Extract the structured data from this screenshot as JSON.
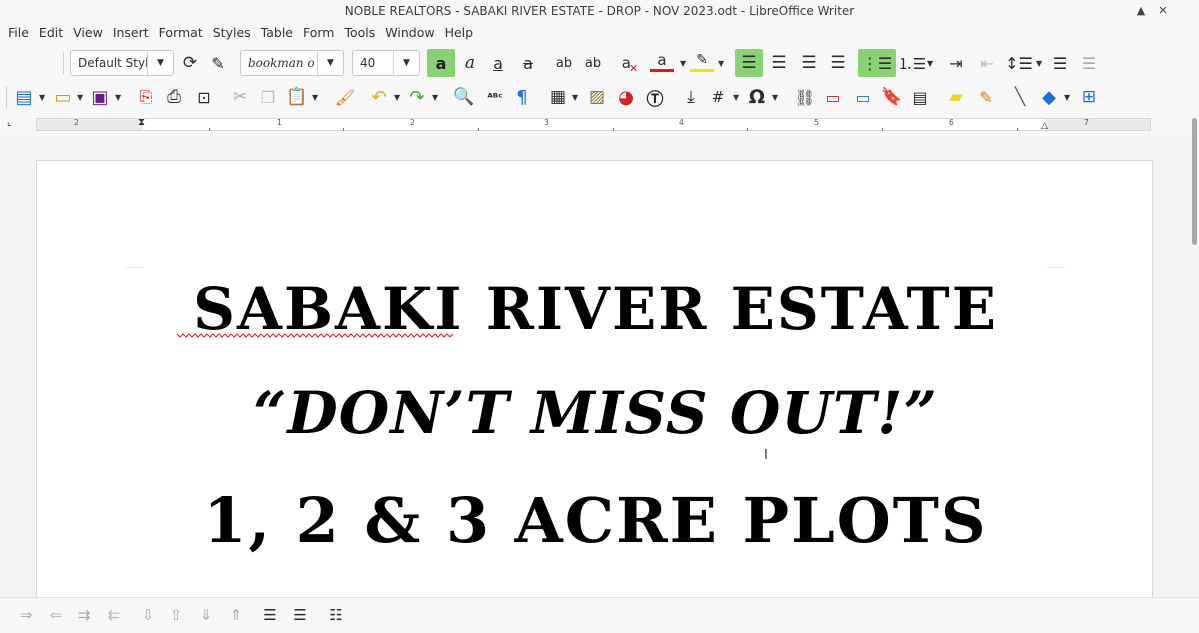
{
  "window": {
    "title": "NOBLE REALTORS - SABAKI RIVER ESTATE - DROP - NOV 2023.odt - LibreOffice Writer",
    "controls": [
      "▲",
      "✕"
    ]
  },
  "menu": [
    "File",
    "Edit",
    "View",
    "Insert",
    "Format",
    "Styles",
    "Table",
    "Form",
    "Tools",
    "Window",
    "Help"
  ],
  "formatting_toolbar": {
    "paragraph_style": "Default Styl",
    "font_name": "bookman ol",
    "font_size": "40"
  },
  "ruler": {
    "numbers": [
      "2",
      "1",
      "1",
      "2",
      "3",
      "4",
      "5",
      "6",
      "7"
    ]
  },
  "document": {
    "lines": [
      "SABAKI RIVER ESTATE",
      "“DON’T MISS OUT!”",
      "1, 2 & 3 ACRE PLOTS"
    ]
  },
  "colors": {
    "active_button": "#8ad175",
    "font_color_bar": "#e01b1b",
    "highlight_bar": "#f5e400",
    "accent_blue": "#1e6fd9"
  }
}
